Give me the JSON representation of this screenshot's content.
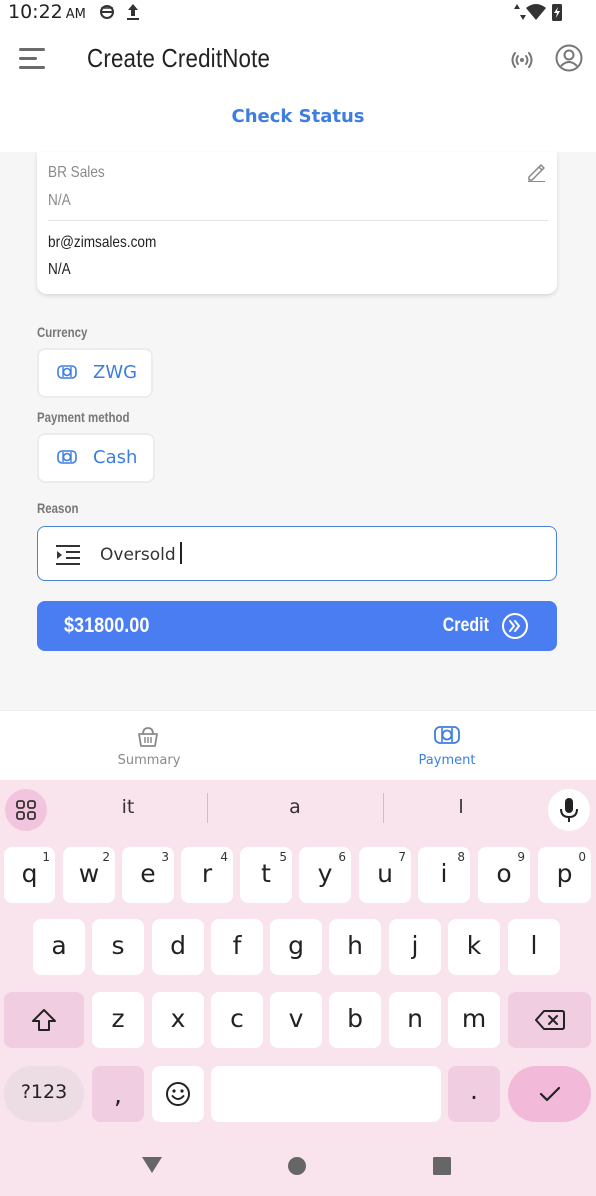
{
  "status_bar": {
    "time": "10:22",
    "ampm": "AM"
  },
  "app_bar": {
    "title": "Create CreditNote"
  },
  "check_status": "Check Status",
  "customer_card": {
    "name": "BR Sales",
    "name_sub": "N/A",
    "email": "br@zimsales.com",
    "email_sub": "N/A"
  },
  "form": {
    "currency_label": "Currency",
    "currency_value": "ZWG",
    "payment_label": "Payment method",
    "payment_value": "Cash",
    "reason_label": "Reason",
    "reason_value": "Oversold"
  },
  "credit_button": {
    "amount": "$31800.00",
    "label": "Credit"
  },
  "bottom_nav": {
    "items": [
      {
        "label": "Summary",
        "color": "#8a8a8a"
      },
      {
        "label": "Payment",
        "color": "#3d7ee0"
      }
    ]
  },
  "keyboard": {
    "suggestions": [
      "it",
      "a",
      "l"
    ],
    "row1": [
      {
        "k": "q",
        "n": "1"
      },
      {
        "k": "w",
        "n": "2"
      },
      {
        "k": "e",
        "n": "3"
      },
      {
        "k": "r",
        "n": "4"
      },
      {
        "k": "t",
        "n": "5"
      },
      {
        "k": "y",
        "n": "6"
      },
      {
        "k": "u",
        "n": "7"
      },
      {
        "k": "i",
        "n": "8"
      },
      {
        "k": "o",
        "n": "9"
      },
      {
        "k": "p",
        "n": "0"
      }
    ],
    "row2": [
      "a",
      "s",
      "d",
      "f",
      "g",
      "h",
      "j",
      "k",
      "l"
    ],
    "row3": [
      "z",
      "x",
      "c",
      "v",
      "b",
      "n",
      "m"
    ],
    "sym_label": "?123",
    "comma": ",",
    "period": "."
  },
  "colors": {
    "accent": "#3d7ee0",
    "button": "#4a7cf2",
    "keyboard_bg": "#f9e4ee"
  }
}
